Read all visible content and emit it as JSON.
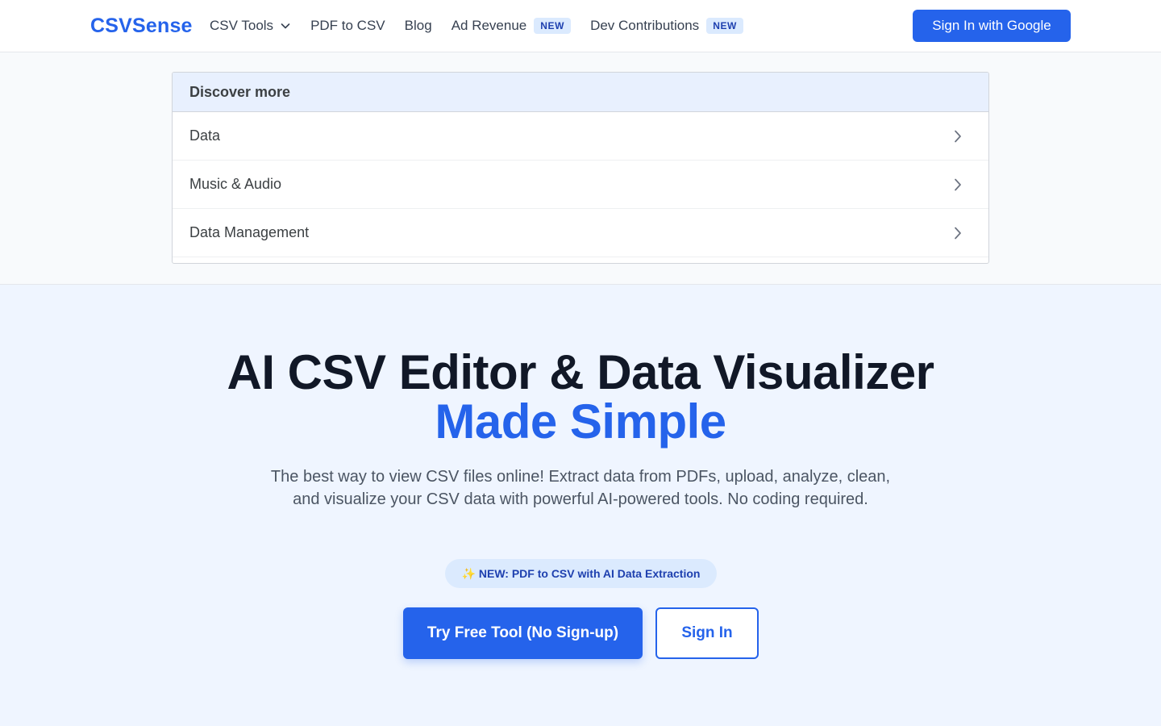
{
  "header": {
    "brand": "CSVSense",
    "nav": [
      {
        "label": "CSV Tools",
        "icon": "chevron-down-icon"
      },
      {
        "label": "PDF to CSV"
      },
      {
        "label": "Blog"
      },
      {
        "label": "Ad Revenue",
        "badge": "NEW"
      },
      {
        "label": "Dev Contributions",
        "badge": "NEW"
      }
    ],
    "signin_label": "Sign In with Google"
  },
  "discover": {
    "heading": "Discover more",
    "items": [
      {
        "label": "Data",
        "icon": "chevron-right-icon"
      },
      {
        "label": "Music & Audio",
        "icon": "chevron-right-icon"
      },
      {
        "label": "Data Management",
        "icon": "chevron-right-icon"
      }
    ]
  },
  "hero": {
    "title_line1": "AI CSV Editor & Data Visualizer",
    "title_line2": "Made Simple",
    "subtitle": "The best way to view CSV files online! Extract data from PDFs, upload, analyze, clean, and visualize your CSV data with powerful AI-powered tools. No coding required.",
    "pill": "✨ NEW: PDF to CSV with AI Data Extraction",
    "cta_primary": "Try Free Tool (No Sign-up)",
    "cta_secondary": "Sign In"
  },
  "colors": {
    "brand": "#2563eb",
    "badge_bg": "#dbeafe",
    "badge_text": "#1e40af",
    "hero_bg": "#eff5ff"
  }
}
